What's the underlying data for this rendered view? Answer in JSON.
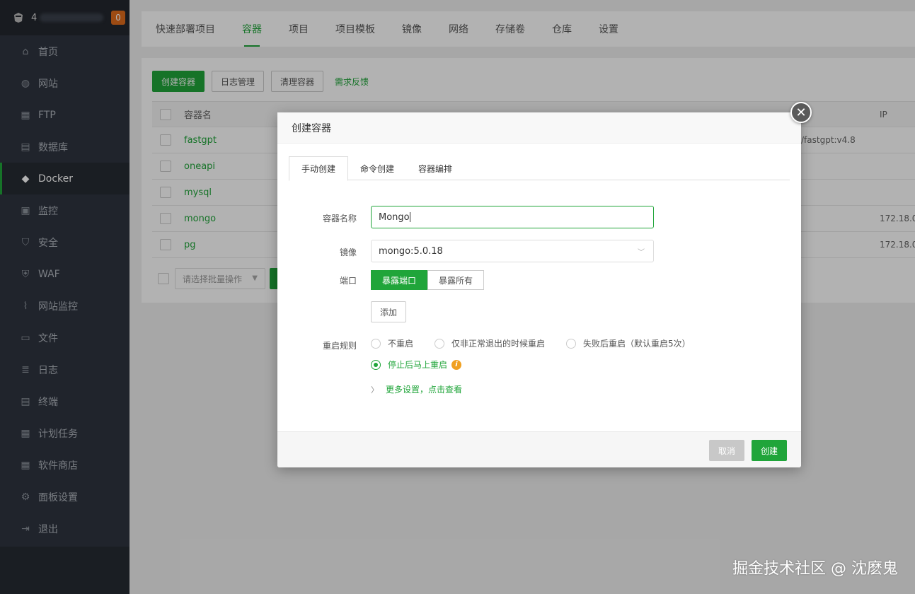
{
  "sidebar": {
    "title_prefix": "4",
    "badge": "0",
    "items": [
      {
        "label": "首页",
        "icon": "home-icon"
      },
      {
        "label": "网站",
        "icon": "globe-icon"
      },
      {
        "label": "FTP",
        "icon": "ftp-icon"
      },
      {
        "label": "数据库",
        "icon": "database-icon"
      },
      {
        "label": "Docker",
        "icon": "docker-icon"
      },
      {
        "label": "监控",
        "icon": "monitor-icon"
      },
      {
        "label": "安全",
        "icon": "shield-icon"
      },
      {
        "label": "WAF",
        "icon": "waf-icon"
      },
      {
        "label": "网站监控",
        "icon": "chart-line-icon"
      },
      {
        "label": "文件",
        "icon": "folder-icon"
      },
      {
        "label": "日志",
        "icon": "log-icon"
      },
      {
        "label": "终端",
        "icon": "terminal-icon"
      },
      {
        "label": "计划任务",
        "icon": "calendar-icon"
      },
      {
        "label": "软件商店",
        "icon": "store-icon"
      },
      {
        "label": "面板设置",
        "icon": "gear-icon"
      },
      {
        "label": "退出",
        "icon": "logout-icon"
      }
    ]
  },
  "topbar": {
    "tabs": [
      "快速部署项目",
      "容器",
      "项目",
      "项目模板",
      "镜像",
      "网络",
      "存储卷",
      "仓库",
      "设置"
    ]
  },
  "toolbar": {
    "create": "创建容器",
    "logs": "日志管理",
    "clean": "清理容器",
    "feedback": "需求反馈"
  },
  "table": {
    "headers": {
      "name": "容器名",
      "ip": "IP"
    },
    "rows": [
      {
        "name": "fastgpt",
        "image": "/fastgpt:v4.8",
        "ip": ""
      },
      {
        "name": "oneapi",
        "image": "",
        "ip": ""
      },
      {
        "name": "mysql",
        "image": "",
        "ip": ""
      },
      {
        "name": "mongo",
        "image": "",
        "ip": "172.18.0."
      },
      {
        "name": "pg",
        "image": "",
        "ip": "172.18.0."
      }
    ],
    "batch_placeholder": "请选择批量操作"
  },
  "modal": {
    "title": "创建容器",
    "tabs": [
      "手动创建",
      "命令创建",
      "容器编排"
    ],
    "name_label": "容器名称",
    "name_value": "Mongo",
    "image_label": "镜像",
    "image_value": "mongo:5.0.18",
    "port_label": "端口",
    "port_expose": "暴露端口",
    "port_expose_all": "暴露所有",
    "add": "添加",
    "restart_label": "重启规则",
    "restart_options": [
      "不重启",
      "仅非正常退出的时候重启",
      "失败后重启（默认重启5次）",
      "停止后马上重启"
    ],
    "more_settings": "更多设置，点击查看",
    "cancel": "取消",
    "create": "创建"
  },
  "watermark": "掘金技术社区 @ 沈麽鬼"
}
